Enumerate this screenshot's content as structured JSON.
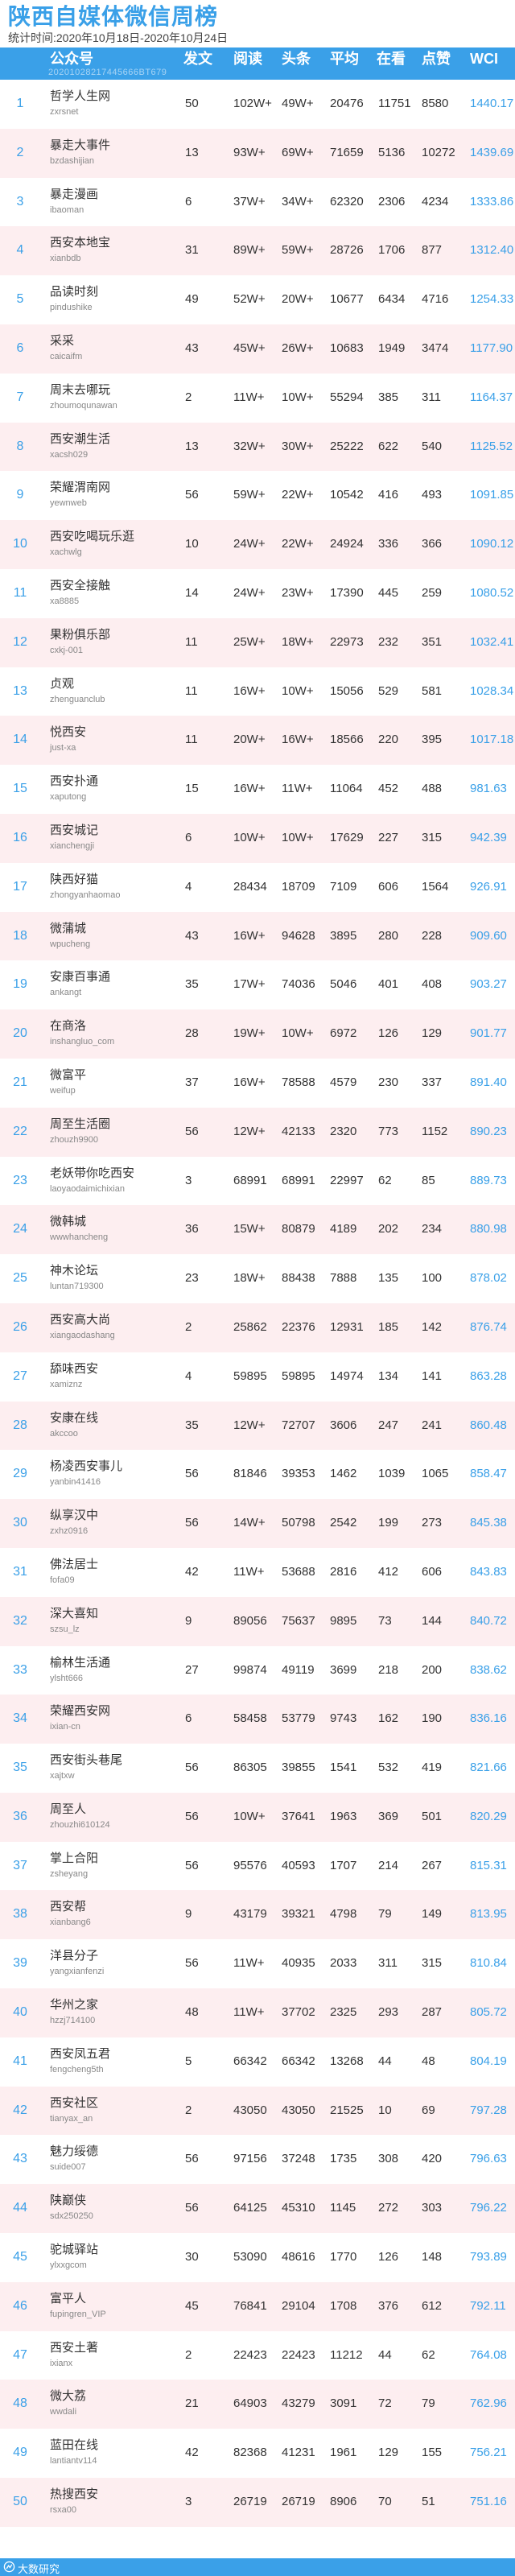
{
  "title": "陕西自媒体微信周榜",
  "stat_period": "统计时间:2020年10月18日-2020年10月24日",
  "header": {
    "columns": [
      "公众号",
      "发文",
      "阅读",
      "头条",
      "平均",
      "在看",
      "点赞",
      "WCI"
    ],
    "watermark": "20201028217445666BT679"
  },
  "footer": {
    "brand": "大数研究"
  },
  "colors": {
    "accent": "#3aa0e8",
    "alt_row": "#fdeef0",
    "rank_text": "#3aa0e8"
  },
  "rows": [
    {
      "rank": "1",
      "name": "哲学人生网",
      "id": "zxrsnet",
      "posts": "50",
      "read": "102W+",
      "top": "49W+",
      "avg": "20476",
      "look": "11751",
      "like": "8580",
      "wci": "1440.17"
    },
    {
      "rank": "2",
      "name": "暴走大事件",
      "id": "bzdashijian",
      "posts": "13",
      "read": "93W+",
      "top": "69W+",
      "avg": "71659",
      "look": "5136",
      "like": "10272",
      "wci": "1439.69"
    },
    {
      "rank": "3",
      "name": "暴走漫画",
      "id": "ibaoman",
      "posts": "6",
      "read": "37W+",
      "top": "34W+",
      "avg": "62320",
      "look": "2306",
      "like": "4234",
      "wci": "1333.86"
    },
    {
      "rank": "4",
      "name": "西安本地宝",
      "id": "xianbdb",
      "posts": "31",
      "read": "89W+",
      "top": "59W+",
      "avg": "28726",
      "look": "1706",
      "like": "877",
      "wci": "1312.40"
    },
    {
      "rank": "5",
      "name": "品读时刻",
      "id": "pindushike",
      "posts": "49",
      "read": "52W+",
      "top": "20W+",
      "avg": "10677",
      "look": "6434",
      "like": "4716",
      "wci": "1254.33"
    },
    {
      "rank": "6",
      "name": "采采",
      "id": "caicaifm",
      "posts": "43",
      "read": "45W+",
      "top": "26W+",
      "avg": "10683",
      "look": "1949",
      "like": "3474",
      "wci": "1177.90"
    },
    {
      "rank": "7",
      "name": "周末去哪玩",
      "id": "zhoumoqunawan",
      "posts": "2",
      "read": "11W+",
      "top": "10W+",
      "avg": "55294",
      "look": "385",
      "like": "311",
      "wci": "1164.37"
    },
    {
      "rank": "8",
      "name": "西安潮生活",
      "id": "xacsh029",
      "posts": "13",
      "read": "32W+",
      "top": "30W+",
      "avg": "25222",
      "look": "622",
      "like": "540",
      "wci": "1125.52"
    },
    {
      "rank": "9",
      "name": "荣耀渭南网",
      "id": "yewnweb",
      "posts": "56",
      "read": "59W+",
      "top": "22W+",
      "avg": "10542",
      "look": "416",
      "like": "493",
      "wci": "1091.85"
    },
    {
      "rank": "10",
      "name": "西安吃喝玩乐逛",
      "id": "xachwlg",
      "posts": "10",
      "read": "24W+",
      "top": "22W+",
      "avg": "24924",
      "look": "336",
      "like": "366",
      "wci": "1090.12"
    },
    {
      "rank": "11",
      "name": "西安全接触",
      "id": "xa8885",
      "posts": "14",
      "read": "24W+",
      "top": "23W+",
      "avg": "17390",
      "look": "445",
      "like": "259",
      "wci": "1080.52"
    },
    {
      "rank": "12",
      "name": "果粉俱乐部",
      "id": "cxkj-001",
      "posts": "11",
      "read": "25W+",
      "top": "18W+",
      "avg": "22973",
      "look": "232",
      "like": "351",
      "wci": "1032.41"
    },
    {
      "rank": "13",
      "name": "贞观",
      "id": "zhenguanclub",
      "posts": "11",
      "read": "16W+",
      "top": "10W+",
      "avg": "15056",
      "look": "529",
      "like": "581",
      "wci": "1028.34"
    },
    {
      "rank": "14",
      "name": "悦西安",
      "id": "just-xa",
      "posts": "11",
      "read": "20W+",
      "top": "16W+",
      "avg": "18566",
      "look": "220",
      "like": "395",
      "wci": "1017.18"
    },
    {
      "rank": "15",
      "name": "西安扑通",
      "id": "xaputong",
      "posts": "15",
      "read": "16W+",
      "top": "11W+",
      "avg": "11064",
      "look": "452",
      "like": "488",
      "wci": "981.63"
    },
    {
      "rank": "16",
      "name": "西安城记",
      "id": "xianchengji",
      "posts": "6",
      "read": "10W+",
      "top": "10W+",
      "avg": "17629",
      "look": "227",
      "like": "315",
      "wci": "942.39"
    },
    {
      "rank": "17",
      "name": "陕西好猫",
      "id": "zhongyanhaomao",
      "posts": "4",
      "read": "28434",
      "top": "18709",
      "avg": "7109",
      "look": "606",
      "like": "1564",
      "wci": "926.91"
    },
    {
      "rank": "18",
      "name": "微蒲城",
      "id": "wpucheng",
      "posts": "43",
      "read": "16W+",
      "top": "94628",
      "avg": "3895",
      "look": "280",
      "like": "228",
      "wci": "909.60"
    },
    {
      "rank": "19",
      "name": "安康百事通",
      "id": "ankangt",
      "posts": "35",
      "read": "17W+",
      "top": "74036",
      "avg": "5046",
      "look": "401",
      "like": "408",
      "wci": "903.27"
    },
    {
      "rank": "20",
      "name": "在商洛",
      "id": "inshangluo_com",
      "posts": "28",
      "read": "19W+",
      "top": "10W+",
      "avg": "6972",
      "look": "126",
      "like": "129",
      "wci": "901.77"
    },
    {
      "rank": "21",
      "name": "微富平",
      "id": "weifup",
      "posts": "37",
      "read": "16W+",
      "top": "78588",
      "avg": "4579",
      "look": "230",
      "like": "337",
      "wci": "891.40"
    },
    {
      "rank": "22",
      "name": "周至生活圈",
      "id": "zhouzh9900",
      "posts": "56",
      "read": "12W+",
      "top": "42133",
      "avg": "2320",
      "look": "773",
      "like": "1152",
      "wci": "890.23"
    },
    {
      "rank": "23",
      "name": "老妖带你吃西安",
      "id": "laoyaodaimichixian",
      "posts": "3",
      "read": "68991",
      "top": "68991",
      "avg": "22997",
      "look": "62",
      "like": "85",
      "wci": "889.73"
    },
    {
      "rank": "24",
      "name": "微韩城",
      "id": "wwwhancheng",
      "posts": "36",
      "read": "15W+",
      "top": "80879",
      "avg": "4189",
      "look": "202",
      "like": "234",
      "wci": "880.98"
    },
    {
      "rank": "25",
      "name": "神木论坛",
      "id": "luntan719300",
      "posts": "23",
      "read": "18W+",
      "top": "88438",
      "avg": "7888",
      "look": "135",
      "like": "100",
      "wci": "878.02"
    },
    {
      "rank": "26",
      "name": "西安高大尚",
      "id": "xiangaodashang",
      "posts": "2",
      "read": "25862",
      "top": "22376",
      "avg": "12931",
      "look": "185",
      "like": "142",
      "wci": "876.74"
    },
    {
      "rank": "27",
      "name": "舔味西安",
      "id": "xamiznz",
      "posts": "4",
      "read": "59895",
      "top": "59895",
      "avg": "14974",
      "look": "134",
      "like": "141",
      "wci": "863.28"
    },
    {
      "rank": "28",
      "name": "安康在线",
      "id": "akccoo",
      "posts": "35",
      "read": "12W+",
      "top": "72707",
      "avg": "3606",
      "look": "247",
      "like": "241",
      "wci": "860.48"
    },
    {
      "rank": "29",
      "name": "杨凌西安事儿",
      "id": "yanbin41416",
      "posts": "56",
      "read": "81846",
      "top": "39353",
      "avg": "1462",
      "look": "1039",
      "like": "1065",
      "wci": "858.47"
    },
    {
      "rank": "30",
      "name": "纵享汉中",
      "id": "zxhz0916",
      "posts": "56",
      "read": "14W+",
      "top": "50798",
      "avg": "2542",
      "look": "199",
      "like": "273",
      "wci": "845.38"
    },
    {
      "rank": "31",
      "name": "佛法居士",
      "id": "fofa09",
      "posts": "42",
      "read": "11W+",
      "top": "53688",
      "avg": "2816",
      "look": "412",
      "like": "606",
      "wci": "843.83"
    },
    {
      "rank": "32",
      "name": "深大喜知",
      "id": "szsu_lz",
      "posts": "9",
      "read": "89056",
      "top": "75637",
      "avg": "9895",
      "look": "73",
      "like": "144",
      "wci": "840.72"
    },
    {
      "rank": "33",
      "name": "榆林生活通",
      "id": "ylsht666",
      "posts": "27",
      "read": "99874",
      "top": "49119",
      "avg": "3699",
      "look": "218",
      "like": "200",
      "wci": "838.62"
    },
    {
      "rank": "34",
      "name": "荣耀西安网",
      "id": "ixian-cn",
      "posts": "6",
      "read": "58458",
      "top": "53779",
      "avg": "9743",
      "look": "162",
      "like": "190",
      "wci": "836.16"
    },
    {
      "rank": "35",
      "name": "西安街头巷尾",
      "id": "xajtxw",
      "posts": "56",
      "read": "86305",
      "top": "39855",
      "avg": "1541",
      "look": "532",
      "like": "419",
      "wci": "821.66"
    },
    {
      "rank": "36",
      "name": "周至人",
      "id": "zhouzhi610124",
      "posts": "56",
      "read": "10W+",
      "top": "37641",
      "avg": "1963",
      "look": "369",
      "like": "501",
      "wci": "820.29"
    },
    {
      "rank": "37",
      "name": "掌上合阳",
      "id": "zsheyang",
      "posts": "56",
      "read": "95576",
      "top": "40593",
      "avg": "1707",
      "look": "214",
      "like": "267",
      "wci": "815.31"
    },
    {
      "rank": "38",
      "name": "西安帮",
      "id": "xianbang6",
      "posts": "9",
      "read": "43179",
      "top": "39321",
      "avg": "4798",
      "look": "79",
      "like": "149",
      "wci": "813.95"
    },
    {
      "rank": "39",
      "name": "洋县分子",
      "id": "yangxianfenzi",
      "posts": "56",
      "read": "11W+",
      "top": "40935",
      "avg": "2033",
      "look": "311",
      "like": "315",
      "wci": "810.84"
    },
    {
      "rank": "40",
      "name": "华州之家",
      "id": "hzzj714100",
      "posts": "48",
      "read": "11W+",
      "top": "37702",
      "avg": "2325",
      "look": "293",
      "like": "287",
      "wci": "805.72"
    },
    {
      "rank": "41",
      "name": "西安凤五君",
      "id": "fengcheng5th",
      "posts": "5",
      "read": "66342",
      "top": "66342",
      "avg": "13268",
      "look": "44",
      "like": "48",
      "wci": "804.19"
    },
    {
      "rank": "42",
      "name": "西安社区",
      "id": "tianyax_an",
      "posts": "2",
      "read": "43050",
      "top": "43050",
      "avg": "21525",
      "look": "10",
      "like": "69",
      "wci": "797.28"
    },
    {
      "rank": "43",
      "name": "魅力绥德",
      "id": "suide007",
      "posts": "56",
      "read": "97156",
      "top": "37248",
      "avg": "1735",
      "look": "308",
      "like": "420",
      "wci": "796.63"
    },
    {
      "rank": "44",
      "name": "陕巅侠",
      "id": "sdx250250",
      "posts": "56",
      "read": "64125",
      "top": "45310",
      "avg": "1145",
      "look": "272",
      "like": "303",
      "wci": "796.22"
    },
    {
      "rank": "45",
      "name": "驼城驿站",
      "id": "ylxxgcom",
      "posts": "30",
      "read": "53090",
      "top": "48616",
      "avg": "1770",
      "look": "126",
      "like": "148",
      "wci": "793.89"
    },
    {
      "rank": "46",
      "name": "富平人",
      "id": "fupingren_VIP",
      "posts": "45",
      "read": "76841",
      "top": "29104",
      "avg": "1708",
      "look": "376",
      "like": "612",
      "wci": "792.11"
    },
    {
      "rank": "47",
      "name": "西安土著",
      "id": "ixianx",
      "posts": "2",
      "read": "22423",
      "top": "22423",
      "avg": "11212",
      "look": "44",
      "like": "62",
      "wci": "764.08"
    },
    {
      "rank": "48",
      "name": "微大荔",
      "id": "wwdali",
      "posts": "21",
      "read": "64903",
      "top": "43279",
      "avg": "3091",
      "look": "72",
      "like": "79",
      "wci": "762.96"
    },
    {
      "rank": "49",
      "name": "蓝田在线",
      "id": "lantiantv114",
      "posts": "42",
      "read": "82368",
      "top": "41231",
      "avg": "1961",
      "look": "129",
      "like": "155",
      "wci": "756.21"
    },
    {
      "rank": "50",
      "name": "热搜西安",
      "id": "rsxa00",
      "posts": "3",
      "read": "26719",
      "top": "26719",
      "avg": "8906",
      "look": "70",
      "like": "51",
      "wci": "751.16"
    }
  ]
}
